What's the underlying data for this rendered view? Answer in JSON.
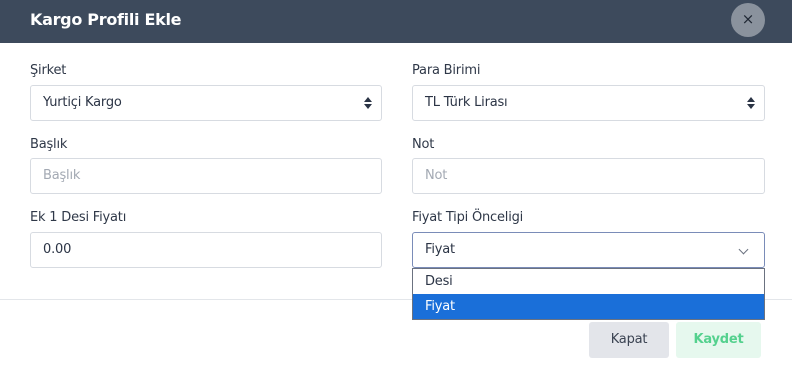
{
  "modal": {
    "title": "Kargo Profili Ekle",
    "close_symbol": "×"
  },
  "form": {
    "company": {
      "label": "Şirket",
      "value": "Yurtiçi Kargo"
    },
    "currency": {
      "label": "Para Birimi",
      "value": "TL Türk Lirası"
    },
    "title_field": {
      "label": "Başlık",
      "placeholder": "Başlık",
      "value": ""
    },
    "note": {
      "label": "Not",
      "placeholder": "Not",
      "value": ""
    },
    "extra_desi_price": {
      "label": "Ek 1 Desi Fiyatı",
      "value": "0.00"
    },
    "price_type_priority": {
      "label": "Fiyat Tipi Önceligi",
      "value": "Fiyat",
      "options": [
        "Desi",
        "Fiyat"
      ],
      "selected_index": 1
    }
  },
  "footer": {
    "close_label": "Kapat",
    "save_label": "Kaydet"
  },
  "colors": {
    "header_bg": "#3d4a5c",
    "selected_option": "#1a6fd9",
    "save_text": "#54d18e"
  },
  "icons": {
    "close": "close-icon",
    "select_arrows": "sort-arrows-icon",
    "dropdown": "chevron-down-icon"
  }
}
